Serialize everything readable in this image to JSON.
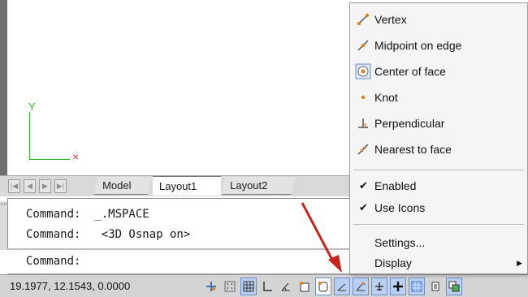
{
  "drawing": {
    "axis_y_label": "Y",
    "axis_x_label": "×"
  },
  "layout_tabs": {
    "nav_buttons": [
      "|◀",
      "◀",
      "▶",
      "▶|"
    ],
    "tabs": [
      "Model",
      "Layout1",
      "Layout2"
    ],
    "active_tab": "Layout1"
  },
  "command_window": {
    "history": [
      "Command:  _.MSPACE",
      "Command:   <3D Osnap on>"
    ],
    "prompt": "Command:"
  },
  "status_bar": {
    "coordinates": "19.1977, 12.1543, 0.0000",
    "buttons": [
      "infer-constraints",
      "snap-mode",
      "grid-display",
      "ortho-mode",
      "polar-tracking",
      "object-snap",
      "3d-object-snap",
      "object-snap-tracking",
      "dynamic-ucs",
      "dynamic-input",
      "lineweight",
      "transparency",
      "quick-properties",
      "selection-cycling"
    ]
  },
  "context_menu": {
    "items": [
      {
        "label": "Vertex",
        "icon": "vertex-icon"
      },
      {
        "label": "Midpoint on edge",
        "icon": "midpoint-icon"
      },
      {
        "label": "Center of face",
        "icon": "center-of-face-icon"
      },
      {
        "label": "Knot",
        "icon": "knot-icon"
      },
      {
        "label": "Perpendicular",
        "icon": "perpendicular-icon"
      },
      {
        "label": "Nearest to face",
        "icon": "nearest-icon"
      }
    ],
    "toggles": [
      {
        "label": "Enabled",
        "checked": true
      },
      {
        "label": "Use Icons",
        "checked": true
      }
    ],
    "settings_label": "Settings...",
    "display_label": "Display"
  },
  "colors": {
    "axis_green": "#2ab52a",
    "axis_red": "#e03030",
    "arrow_red": "#c8231c",
    "button_on_blue": "#b9d0f2"
  }
}
